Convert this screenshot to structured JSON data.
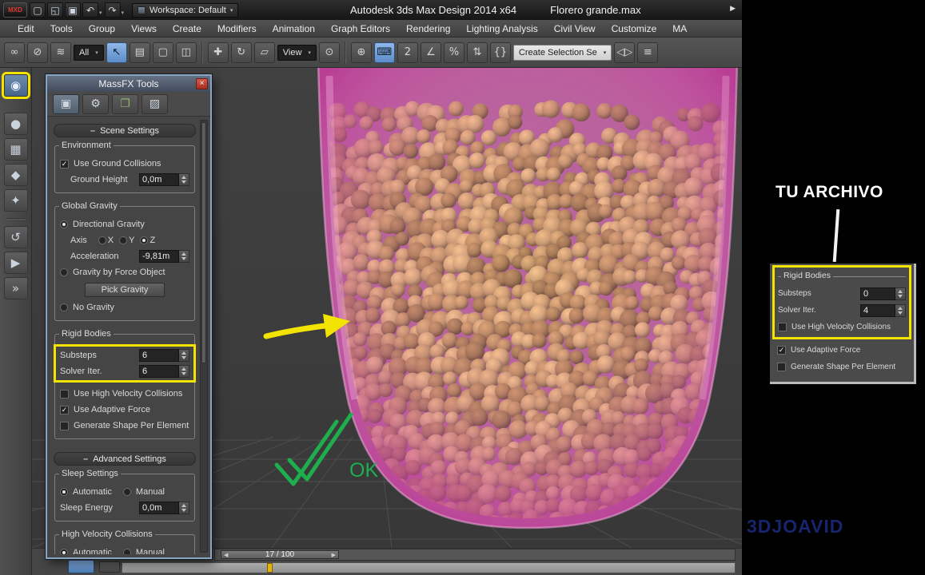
{
  "ui": {
    "caret_glyph": "▾",
    "check_glyph": "✓",
    "close_glyph": "×",
    "collapse_glyph": "–"
  },
  "titlebar": {
    "app_button_label": "MXD",
    "title": "Autodesk 3ds Max Design 2014 x64",
    "document": "Florero grande.max",
    "workspace_label": "Workspace: Default",
    "overflow_glyph": "▶",
    "quick_access": [
      {
        "name": "new-file-icon",
        "glyph": "▢"
      },
      {
        "name": "open-file-icon",
        "glyph": "◱"
      },
      {
        "name": "save-file-icon",
        "glyph": "▣"
      },
      {
        "name": "undo-icon",
        "glyph": "↶",
        "caret": true
      },
      {
        "name": "redo-icon",
        "glyph": "↷",
        "caret": true
      }
    ]
  },
  "menubar": {
    "items": [
      "Edit",
      "Tools",
      "Group",
      "Views",
      "Create",
      "Modifiers",
      "Animation",
      "Graph Editors",
      "Rendering",
      "Lighting Analysis",
      "Civil View",
      "Customize",
      "MA"
    ]
  },
  "main_toolbar": {
    "items": [
      {
        "type": "btn",
        "name": "select-and-link-icon",
        "glyph": "∞"
      },
      {
        "type": "btn",
        "name": "unlink-selection-icon",
        "glyph": "⊘"
      },
      {
        "type": "btn",
        "name": "bind-to-space-warp-icon",
        "glyph": "≋"
      },
      {
        "type": "dropdown",
        "name": "selection-filter-dropdown",
        "label": "All"
      },
      {
        "type": "btn",
        "name": "select-object-icon",
        "glyph": "↖",
        "active": true
      },
      {
        "type": "btn",
        "name": "select-by-name-icon",
        "glyph": "▤"
      },
      {
        "type": "btn",
        "name": "rectangular-selection-icon",
        "glyph": "▢"
      },
      {
        "type": "btn",
        "name": "window-crossing-icon",
        "glyph": "◫"
      },
      {
        "type": "sep"
      },
      {
        "type": "btn",
        "name": "select-and-move-icon",
        "glyph": "✚"
      },
      {
        "type": "btn",
        "name": "select-and-rotate-icon",
        "glyph": "↻"
      },
      {
        "type": "btn",
        "name": "select-and-scale-icon",
        "glyph": "▱"
      },
      {
        "type": "dropdown",
        "name": "reference-coordinate-dropdown",
        "label": "View"
      },
      {
        "type": "btn",
        "name": "use-pivot-point-icon",
        "glyph": "⊙"
      },
      {
        "type": "sep"
      },
      {
        "type": "btn",
        "name": "select-and-manipulate-icon",
        "glyph": "⊕"
      },
      {
        "type": "btn",
        "name": "keyboard-override-icon",
        "glyph": "⌨",
        "active": true
      },
      {
        "type": "btn",
        "name": "snap-toggle-icon",
        "glyph": "2"
      },
      {
        "type": "btn",
        "name": "angle-snap-icon",
        "glyph": "∠"
      },
      {
        "type": "btn",
        "name": "percent-snap-icon",
        "glyph": "%"
      },
      {
        "type": "btn",
        "name": "spinner-snap-icon",
        "glyph": "⇅"
      },
      {
        "type": "btn",
        "name": "named-selection-sets-icon",
        "glyph": "{}"
      },
      {
        "type": "dropdown",
        "name": "named-selection-dropdown",
        "label": "Create Selection Se",
        "light": true
      },
      {
        "type": "btn",
        "name": "mirror-icon",
        "glyph": "◁▷"
      },
      {
        "type": "btn",
        "name": "align-icon",
        "glyph": "≡"
      }
    ]
  },
  "left_toolbar": {
    "items": [
      {
        "name": "massfx-tools-icon",
        "glyph": "◉",
        "highlight": true
      },
      {
        "type": "gap"
      },
      {
        "name": "set-dynamic-rigid-body-icon",
        "glyph": "●"
      },
      {
        "name": "set-kinematic-rigid-body-icon",
        "glyph": "▦"
      },
      {
        "name": "set-static-rigid-body-icon",
        "glyph": "◆"
      },
      {
        "name": "mcloth-icon",
        "glyph": "✦"
      },
      {
        "type": "sep"
      },
      {
        "name": "reset-simulation-icon",
        "glyph": "↺"
      },
      {
        "name": "start-simulation-icon",
        "glyph": "▶"
      },
      {
        "name": "step-simulation-icon",
        "glyph": "»"
      }
    ]
  },
  "massfx_dialog": {
    "title": "MassFX Tools",
    "tabs": [
      {
        "name": "tab-world-parameters",
        "glyph": "▣",
        "active": true
      },
      {
        "name": "tab-simulation-tools",
        "glyph": "⚙"
      },
      {
        "name": "tab-multi-object-editor",
        "glyph": "❐",
        "color": "#8fb46a"
      },
      {
        "name": "tab-display-options",
        "glyph": "▨"
      }
    ],
    "scene_settings_label": "Scene Settings",
    "advanced_settings_label": "Advanced Settings",
    "environment": {
      "label": "Environment",
      "use_ground_collisions": "Use Ground Collisions",
      "ground_height_label": "Ground Height",
      "ground_height_value": "0,0m"
    },
    "global_gravity": {
      "label": "Global Gravity",
      "directional_gravity": "Directional Gravity",
      "axis_label": "Axis",
      "axis_x": "X",
      "axis_y": "Y",
      "axis_z": "Z",
      "acceleration_label": "Acceleration",
      "acceleration_value": "-9,81m",
      "gravity_by_force_object": "Gravity by Force Object",
      "pick_gravity_button": "Pick Gravity",
      "no_gravity": "No Gravity"
    },
    "rigid_bodies": {
      "label": "Rigid Bodies",
      "substeps_label": "Substeps",
      "substeps_value": "6",
      "solver_iter_label": "Solver Iter.",
      "solver_iter_value": "6",
      "use_high_velocity_collisions": "Use High Velocity Collisions",
      "use_adaptive_force": "Use Adaptive Force",
      "generate_shape_per_element": "Generate Shape Per Element"
    },
    "sleep_settings": {
      "label": "Sleep Settings",
      "automatic": "Automatic",
      "manual": "Manual",
      "sleep_energy_label": "Sleep Energy",
      "sleep_energy_value": "0,0m"
    },
    "high_velocity_collisions": {
      "label": "High Velocity Collisions",
      "automatic": "Automatic",
      "manual": "Manual"
    }
  },
  "right_panel": {
    "rigid_bodies": {
      "label": "Rigid Bodies",
      "substeps_label": "Substeps",
      "substeps_value": "0",
      "solver_iter_label": "Solver Iter.",
      "solver_iter_value": "4",
      "use_high_velocity_collisions": "Use High Velocity Collisions",
      "use_adaptive_force": "Use Adaptive Force",
      "generate_shape_per_element": "Generate Shape Per Element"
    }
  },
  "annotations": {
    "tu_archivo_label": "TU ARCHIVO",
    "ok_label": "OK",
    "watermark": "3DJOAVID",
    "highlight_yellow": "#f2e400",
    "check_green": "#1fae4e"
  },
  "scene": {
    "vase_pink": "#b4639a",
    "ball_colors": [
      "#caa36b",
      "#b8905a",
      "#d2ac72",
      "#aa8450",
      "#c09a62",
      "#9d7a4a"
    ],
    "watermark_blue": "#18246e"
  },
  "timeline": {
    "frame_display": "17 / 100",
    "prev_glyph": "◀",
    "next_glyph": "▶"
  }
}
